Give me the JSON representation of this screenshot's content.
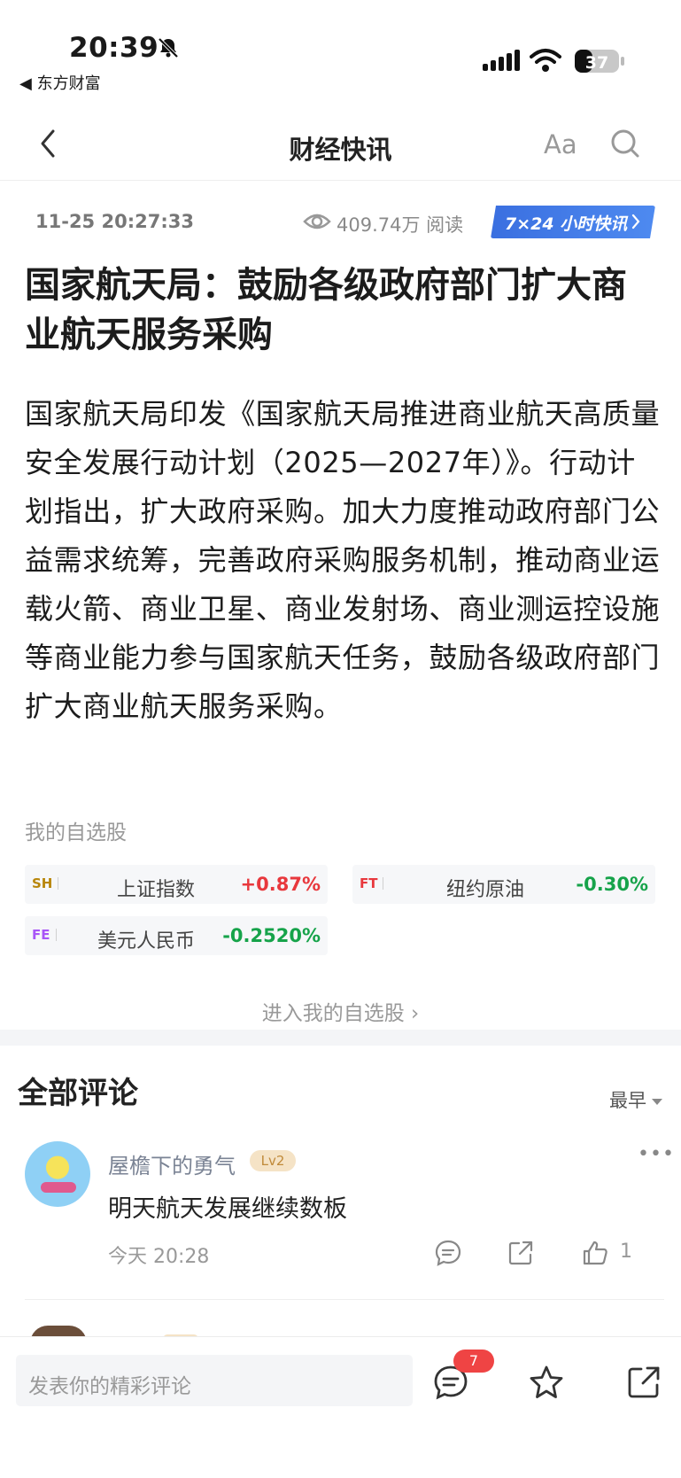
{
  "status_bar": {
    "time": "20:39",
    "back_app": "◀ 东方财富",
    "battery": "37"
  },
  "nav": {
    "title": "财经快讯",
    "font_button": "Aa"
  },
  "meta": {
    "datetime": "11-25 20:27:33",
    "reads": "409.74万 阅读",
    "badge": "7×24 小时快讯"
  },
  "article": {
    "headline": "国家航天局：鼓励各级政府部门扩大商业航天服务采购",
    "body": "国家航天局印发《国家航天局推进商业航天高质量安全发展行动计划（2025—2027年）》。行动计划指出，扩大政府采购。加大力度推动政府部门公益需求统筹，完善政府采购服务机制，推动商业运载火箭、商业卫星、商业发射场、商业测运控设施等商业能力参与国家航天任务，鼓励各级政府部门扩大商业航天服务采购。"
  },
  "watchlist": {
    "title": "我的自选股",
    "items": [
      {
        "code": "SH",
        "name": "上证指数",
        "change": "+0.87%",
        "code_color": "#b8860b",
        "dir": "up"
      },
      {
        "code": "FT",
        "name": "纽约原油",
        "change": "-0.30%",
        "code_color": "#e8383d",
        "dir": "down"
      },
      {
        "code": "FE",
        "name": "美元人民币",
        "change": "-0.2520%",
        "code_color": "#a855f7",
        "dir": "down"
      }
    ],
    "link": "进入我的自选股 ›"
  },
  "comments": {
    "title": "全部评论",
    "sort_label": "最早",
    "items": [
      {
        "user": "屋檐下的勇气",
        "level": "Lv2",
        "text": "明天航天发展继续数板",
        "time": "今天 20:28",
        "likes": "1"
      }
    ]
  },
  "bottom_bar": {
    "input_placeholder": "发表你的精彩评论",
    "comment_count": "7"
  },
  "colors": {
    "accent_blue": "#3a6fe0",
    "up_red": "#e8383d",
    "down_green": "#16a34a"
  }
}
